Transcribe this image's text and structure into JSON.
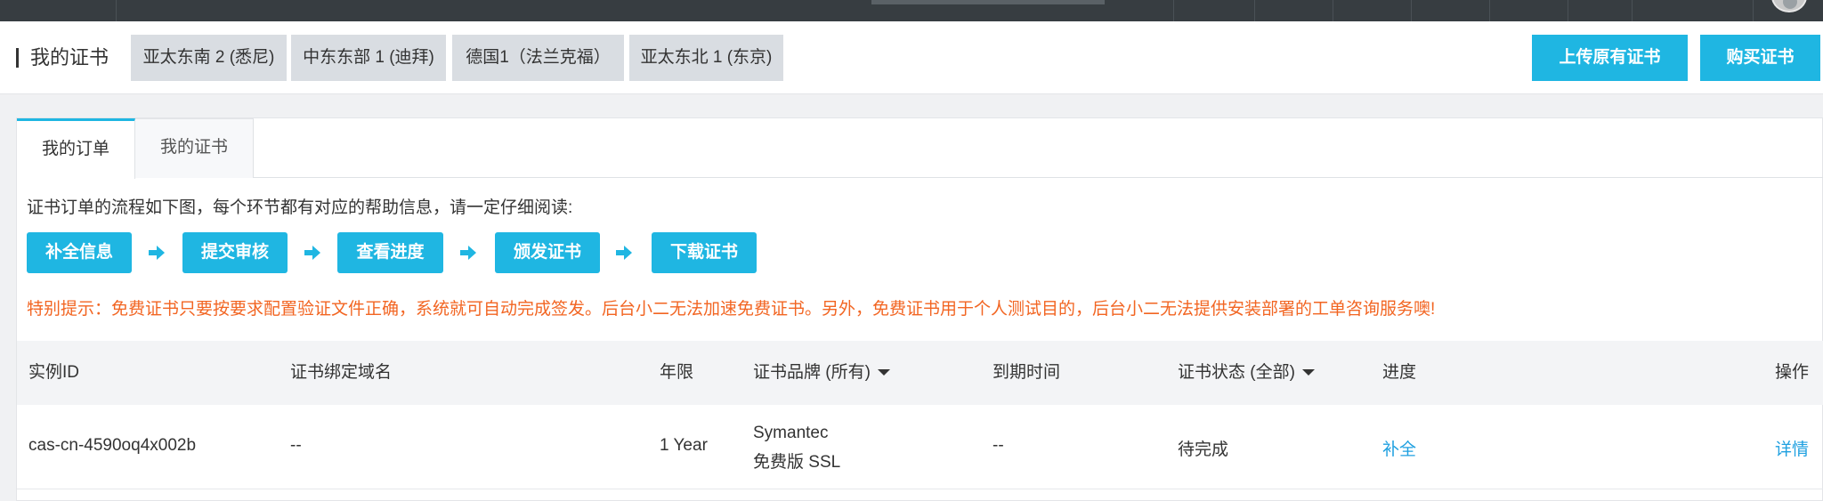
{
  "header": {
    "title": "我的证书",
    "regions": [
      "亚太东南 2 (悉尼)",
      "中东东部 1 (迪拜)",
      "德国1（法兰克福）",
      "亚太东北 1 (东京)"
    ],
    "upload_button": "上传原有证书",
    "buy_button": "购买证书"
  },
  "tabs": [
    "我的订单",
    "我的证书"
  ],
  "intro": "证书订单的流程如下图，每个环节都有对应的帮助信息，请一定仔细阅读:",
  "steps": [
    "补全信息",
    "提交审核",
    "查看进度",
    "颁发证书",
    "下载证书"
  ],
  "notice": "特别提示：免费证书只要按要求配置验证文件正确，系统就可自动完成签发。后台小二无法加速免费证书。另外，免费证书用于个人测试目的，后台小二无法提供安装部署的工单咨询服务噢!",
  "table": {
    "columns": [
      "实例ID",
      "证书绑定域名",
      "年限",
      "证书品牌 (所有)",
      "到期时间",
      "证书状态 (全部)",
      "进度",
      "操作"
    ],
    "rows": [
      {
        "instance_id": "cas-cn-4590oq4x002b",
        "domain": "--",
        "years": "1 Year",
        "brand_line1": "Symantec",
        "brand_line2": "免费版 SSL",
        "expire": "--",
        "status": "待完成",
        "progress": "补全",
        "action": "详情"
      }
    ]
  },
  "colors": {
    "accent": "#1fb6e2",
    "notice": "#f26522",
    "link": "#1fa0e0",
    "topbar": "#373d41"
  }
}
